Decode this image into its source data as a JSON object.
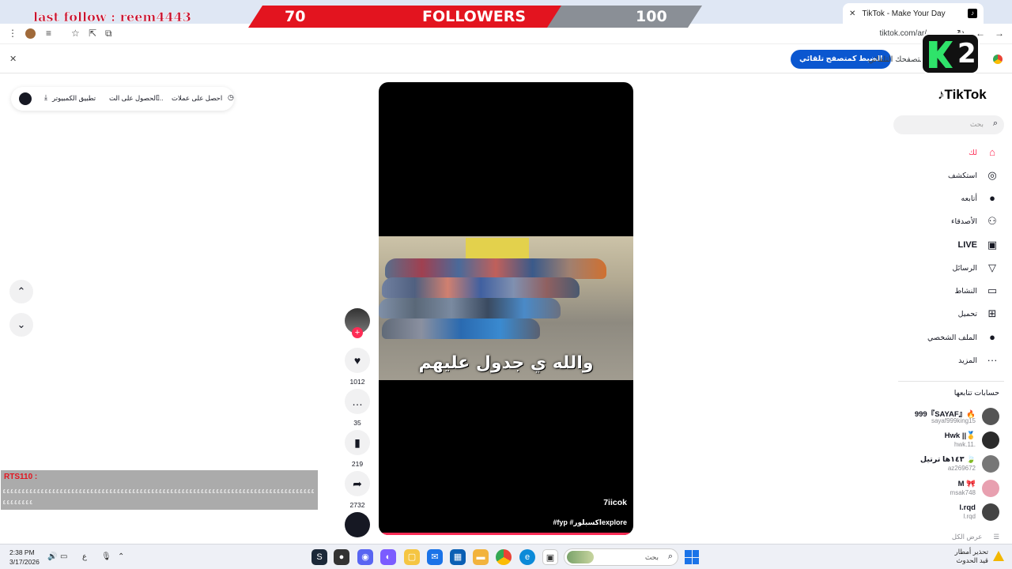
{
  "browser": {
    "tab_title": "TikTok - Make Your Day",
    "tab_close": "✕",
    "new_tab": "+",
    "url": "tiktok.com/ar/"
  },
  "infobar": {
    "button": "الضبط كمتصفح تلقائي",
    "text": "متصفحك التلقائي."
  },
  "overlay": {
    "last_follow": "last follow : reem4443",
    "current": "70",
    "label": "FOLLOWERS",
    "goal": "100",
    "badge_num": "2"
  },
  "top_pill": {
    "coins": "احصل على عملات",
    "app": "الحصول على الت...",
    "pc": "تطبيق الكمبيوتر"
  },
  "video": {
    "caption": "والله ي جدول عليهم",
    "author": "7iicok",
    "description": "#fyp #اكسبلورexplore"
  },
  "actions": {
    "likes": "1012",
    "comments": "35",
    "saves": "219",
    "shares": "2732"
  },
  "sidebar": {
    "logo": "TikTok",
    "search_placeholder": "بحث",
    "items": [
      {
        "label": "لك",
        "icon": "home-icon",
        "glyph": "⌂"
      },
      {
        "label": "استكشف",
        "icon": "compass-icon",
        "glyph": "◎"
      },
      {
        "label": "أتابعه",
        "icon": "following-icon",
        "glyph": "●"
      },
      {
        "label": "الأصدقاء",
        "icon": "friends-icon",
        "glyph": "⚇"
      },
      {
        "label": "LIVE",
        "icon": "live-icon",
        "glyph": "▣"
      },
      {
        "label": "الرسائل",
        "icon": "messages-icon",
        "glyph": "▽"
      },
      {
        "label": "النشاط",
        "icon": "activity-icon",
        "glyph": "▭"
      },
      {
        "label": "تحميل",
        "icon": "upload-icon",
        "glyph": "⊞"
      },
      {
        "label": "الملف الشخصي",
        "icon": "profile-icon",
        "glyph": "●"
      },
      {
        "label": "المزيد",
        "icon": "more-icon",
        "glyph": "···"
      }
    ],
    "following_title": "حسابات تتابعها",
    "accounts": [
      {
        "name": "999『SAYAF』🔥",
        "handle": "sayaf999king15"
      },
      {
        "name": "Hwk ||🥇",
        "handle": "hwk.11."
      },
      {
        "name": "١٤٣ها ترتيل 🍃",
        "handle": "az269672"
      },
      {
        "name": "M 🎀",
        "handle": "msak748"
      },
      {
        "name": "l.rqd",
        "handle": "l.rqd"
      }
    ],
    "see_all": "عرض الكل"
  },
  "chat": {
    "user": "RTS110 :",
    "message": "٤٤٤٤٤٤٤٤٤٤٤٤٤٤٤٤٤٤٤٤٤٤٤٤٤٤٤٤٤٤٤٤٤٤٤٤٤٤٤٤٤٤٤٤٤٤٤٤٤٤٤٤٤٤٤٤٤٤٤٤٤٤٤٤٤٤٤٤٤٤٤٤٤٤٤٤٤٤٤٤٤٤٤٤٤٤٤٤٤٤"
  },
  "taskbar": {
    "time": "2:38 PM",
    "date": "3/17/2026",
    "search_placeholder": "بحث",
    "lang": "ع",
    "weather_line1": "تحذير أمطار",
    "weather_line2": "قيد الحدوث"
  }
}
